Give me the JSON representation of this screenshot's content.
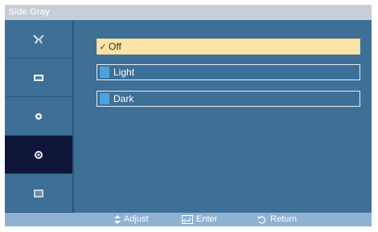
{
  "window": {
    "title": "Side Gray"
  },
  "sidebar": {
    "items": [
      {
        "icon": "picture-icon"
      },
      {
        "icon": "sound-icon"
      },
      {
        "icon": "setup-icon"
      },
      {
        "icon": "settings-icon"
      },
      {
        "icon": "multi-window-icon"
      }
    ],
    "active_index": 3
  },
  "options": [
    {
      "label": "Off",
      "selected": true,
      "checked_mark": "✓"
    },
    {
      "label": "Light",
      "selected": false
    },
    {
      "label": "Dark",
      "selected": false
    }
  ],
  "footer": {
    "adjust_label": "Adjust",
    "enter_label": "Enter",
    "return_label": "Return"
  },
  "colors": {
    "panel": "#3d6f97",
    "title_bar": "#c6cfd8",
    "active_sidebar": "#10163a",
    "highlight": "#fbe4a5",
    "swatch": "#4aa3df",
    "footer": "#8fb2d2"
  }
}
